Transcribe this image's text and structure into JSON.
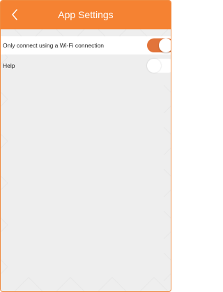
{
  "header": {
    "title": "App Settings",
    "back_icon": "chevron-left-icon"
  },
  "settings": {
    "items": [
      {
        "label": "Only connect using a Wi-Fi connection",
        "enabled": true
      },
      {
        "label": "Help",
        "enabled": false
      }
    ]
  },
  "colors": {
    "accent": "#f58232",
    "background": "#eeeeee",
    "toggle_on": "#e2743a"
  }
}
